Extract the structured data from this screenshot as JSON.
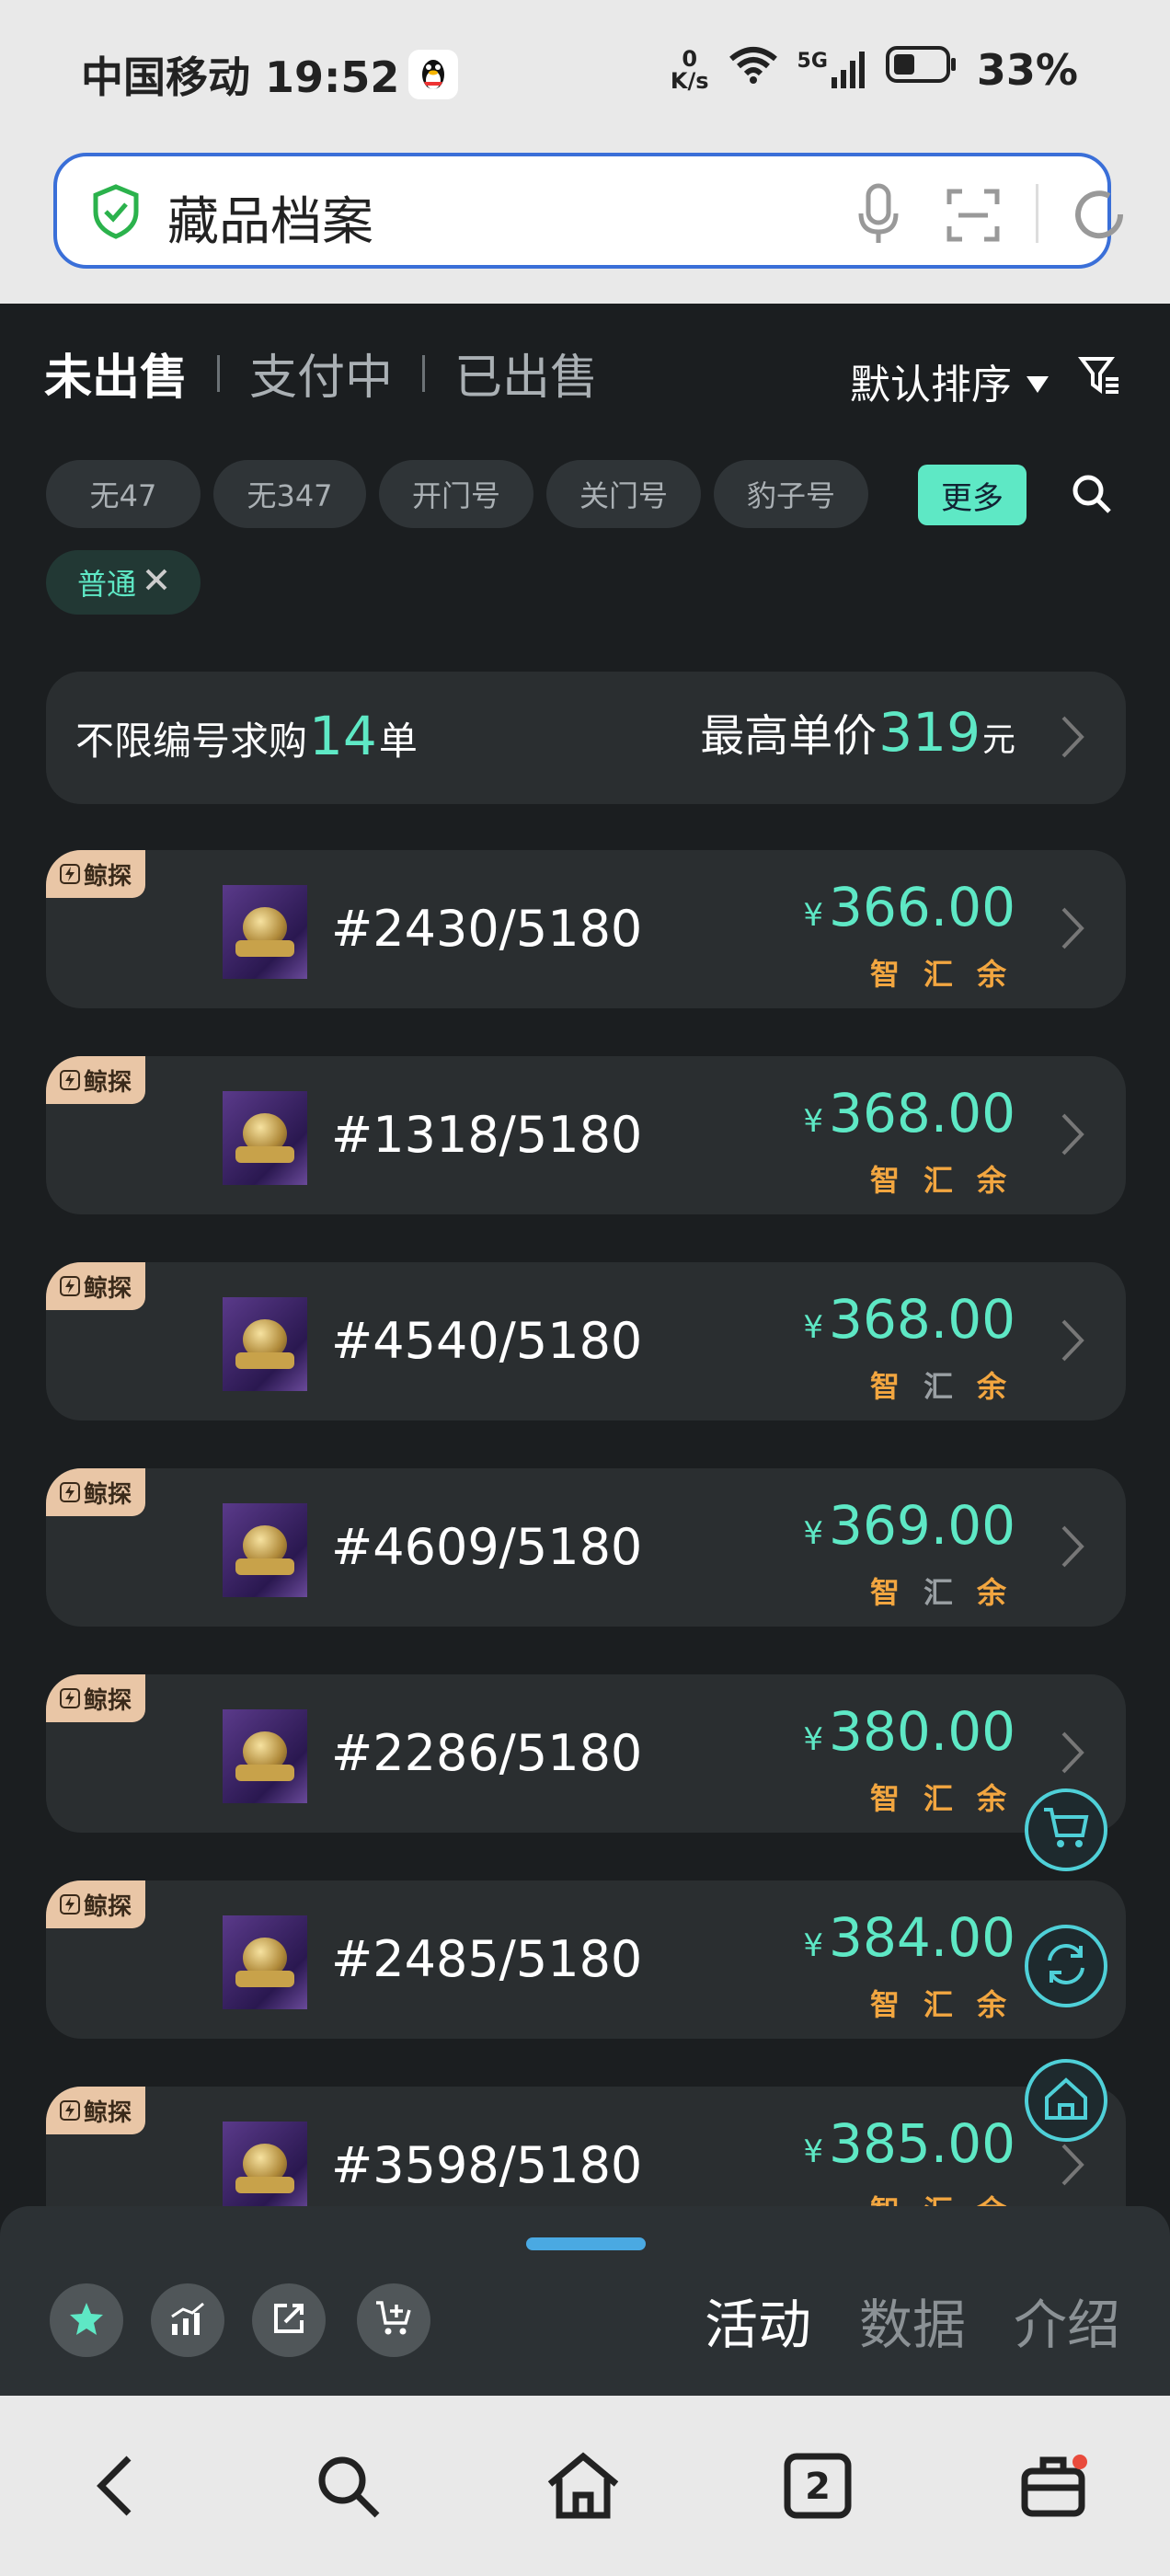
{
  "status_bar": {
    "carrier_time": "中国移动 19:52",
    "net_speed_value": "0",
    "net_speed_unit": "K/s",
    "network": "5G",
    "battery": "33%"
  },
  "address_bar": {
    "title": "藏品档案"
  },
  "tabs": [
    {
      "label": "未出售",
      "active": true
    },
    {
      "label": "支付中",
      "active": false
    },
    {
      "label": "已出售",
      "active": false
    }
  ],
  "sort": {
    "label": "默认排序"
  },
  "filter_chips": [
    "无47",
    "无347",
    "开门号",
    "关门号",
    "豹子号"
  ],
  "more_label": "更多",
  "active_filter": "普通",
  "buy_request": {
    "prefix": "不限编号求购",
    "count": "14",
    "count_unit": "单",
    "max_label": "最高单价",
    "max_price": "319",
    "max_unit": "元"
  },
  "listings": [
    {
      "tag": "鲸探",
      "serial": "#2430/5180",
      "price": "366.00",
      "currency": "¥",
      "sources": [
        "智",
        "汇",
        "余"
      ],
      "sources_active": [
        true,
        true,
        true
      ]
    },
    {
      "tag": "鲸探",
      "serial": "#1318/5180",
      "price": "368.00",
      "currency": "¥",
      "sources": [
        "智",
        "汇",
        "余"
      ],
      "sources_active": [
        true,
        true,
        true
      ]
    },
    {
      "tag": "鲸探",
      "serial": "#4540/5180",
      "price": "368.00",
      "currency": "¥",
      "sources": [
        "智",
        "汇",
        "余"
      ],
      "sources_active": [
        true,
        false,
        true
      ]
    },
    {
      "tag": "鲸探",
      "serial": "#4609/5180",
      "price": "369.00",
      "currency": "¥",
      "sources": [
        "智",
        "汇",
        "余"
      ],
      "sources_active": [
        true,
        false,
        true
      ]
    },
    {
      "tag": "鲸探",
      "serial": "#2286/5180",
      "price": "380.00",
      "currency": "¥",
      "sources": [
        "智",
        "汇",
        "余"
      ],
      "sources_active": [
        true,
        true,
        true
      ]
    },
    {
      "tag": "鲸探",
      "serial": "#2485/5180",
      "price": "384.00",
      "currency": "¥",
      "sources": [
        "智",
        "汇",
        "余"
      ],
      "sources_active": [
        true,
        true,
        true
      ]
    },
    {
      "tag": "鲸探",
      "serial": "#3598/5180",
      "price": "385.00",
      "currency": "¥",
      "sources": [
        "智",
        "汇",
        "余"
      ],
      "sources_active": [
        true,
        true,
        true
      ]
    }
  ],
  "floating_buttons": [
    "cart-icon",
    "refresh-icon",
    "home-icon"
  ],
  "bottom_panel": {
    "action_icons": [
      "star-icon",
      "trend-chart-icon",
      "share-icon",
      "cart-add-icon"
    ],
    "tabs": [
      {
        "label": "活动",
        "active": true
      },
      {
        "label": "数据",
        "active": false
      },
      {
        "label": "介绍",
        "active": false
      }
    ]
  },
  "nav_bar": {
    "tab_count": "2",
    "icons": [
      "back-icon",
      "search-icon",
      "home-icon",
      "tabs-icon",
      "toolbox-icon"
    ]
  },
  "colors": {
    "accent": "#5ee8c5",
    "source_active": "#f2a640",
    "background": "#1b1e20",
    "card": "#2a2e30"
  }
}
